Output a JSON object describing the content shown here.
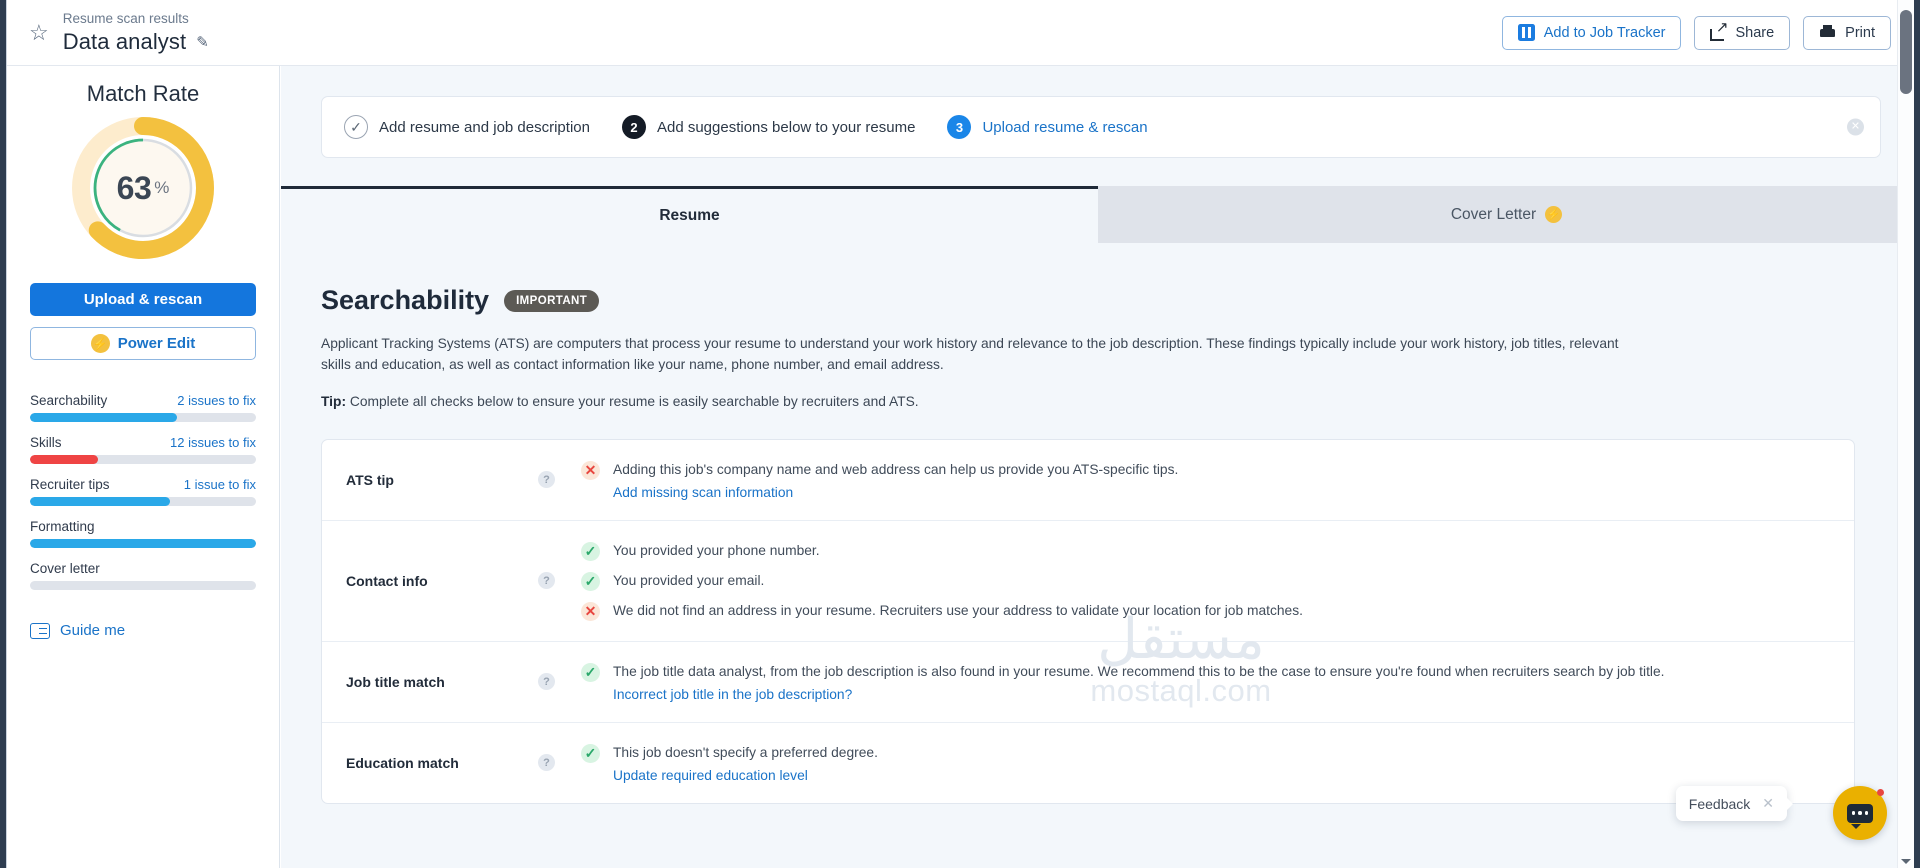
{
  "header": {
    "star_icon": "star-icon",
    "kicker": "Resume scan results",
    "title": "Data analyst",
    "edit_icon": "pencil-icon",
    "actions": [
      {
        "label": "Add to Job Tracker",
        "icon": "job-tracker-icon"
      },
      {
        "label": "Share",
        "icon": "share-icon"
      },
      {
        "label": "Print",
        "icon": "print-icon"
      }
    ]
  },
  "sidebar": {
    "match_rate_title": "Match Rate",
    "gauge": {
      "value": 63,
      "value_text": "63",
      "percent_symbol": "%",
      "outer_ring_color": "#f3c13f",
      "outer_track_color": "#fdeccd",
      "inner_ring_color": "#3bb37f",
      "inner_track_color": "#d9dde2"
    },
    "upload_button": "Upload & rescan",
    "power_edit_button": "Power Edit",
    "power_edit_icon": "bolt-icon",
    "meters": [
      {
        "label": "Searchability",
        "issues": "2 issues to fix",
        "percent": 65,
        "color": "#2aa8e8"
      },
      {
        "label": "Skills",
        "issues": "12 issues to fix",
        "percent": 30,
        "color": "#ef4444"
      },
      {
        "label": "Recruiter tips",
        "issues": "1 issue to fix",
        "percent": 62,
        "color": "#2aa8e8"
      },
      {
        "label": "Formatting",
        "issues": "",
        "percent": 100,
        "color": "#2aa8e8"
      },
      {
        "label": "Cover letter",
        "issues": "",
        "percent": 0,
        "color": "#2aa8e8"
      }
    ],
    "guide_me": "Guide me",
    "guide_icon": "list-check-icon"
  },
  "steps": {
    "items": [
      {
        "bubble": "✓",
        "state": "done",
        "label": "Add resume and job description"
      },
      {
        "bubble": "2",
        "state": "current",
        "label": "Add suggestions below to your resume"
      },
      {
        "bubble": "3",
        "state": "next",
        "label": "Upload resume & rescan"
      }
    ],
    "close_icon": "close-icon"
  },
  "tabs": [
    {
      "label": "Resume",
      "active": true
    },
    {
      "label": "Cover Letter",
      "active": false,
      "icon": "bolt-icon"
    }
  ],
  "section": {
    "title": "Searchability",
    "badge": "IMPORTANT",
    "body": "Applicant Tracking Systems (ATS) are computers that process your resume to understand your work history and relevance to the job description. These findings typically include your work history, job titles, relevant skills and education, as well as contact information like your name, phone number, and email address.",
    "tip_label": "Tip:",
    "tip_text": " Complete all checks below to ensure your resume is easily searchable by recruiters and ATS."
  },
  "checks": [
    {
      "name": "ATS tip",
      "help_icon": "help-icon",
      "items": [
        {
          "mark": "bad",
          "text": "Adding this job's company name and web address can help us provide you ATS-specific tips.",
          "link": "Add missing scan information"
        }
      ]
    },
    {
      "name": "Contact info",
      "help_icon": "help-icon",
      "items": [
        {
          "mark": "ok",
          "text": "You provided your phone number.",
          "link": ""
        },
        {
          "mark": "ok",
          "text": "You provided your email.",
          "link": ""
        },
        {
          "mark": "bad",
          "text": "We did not find an address in your resume. Recruiters use your address to validate your location for job matches.",
          "link": ""
        }
      ]
    },
    {
      "name": "Job title match",
      "help_icon": "help-icon",
      "items": [
        {
          "mark": "ok",
          "text": "The job title data analyst, from the job description is also found in your resume. We recommend this to be the case to ensure you're found when recruiters search by job title.",
          "link": "Incorrect job title in the job description?"
        }
      ]
    },
    {
      "name": "Education match",
      "help_icon": "help-icon",
      "items": [
        {
          "mark": "ok",
          "text": "This job doesn't specify a preferred degree.",
          "link": "Update required education level"
        }
      ]
    }
  ],
  "watermark": {
    "main": "مستقل",
    "sub": "mostaql.com"
  },
  "feedback": {
    "label": "Feedback",
    "close_icon": "close-icon",
    "chat_icon": "chat-bubble-icon"
  },
  "marks": {
    "ok": "✓",
    "bad": "✕"
  }
}
